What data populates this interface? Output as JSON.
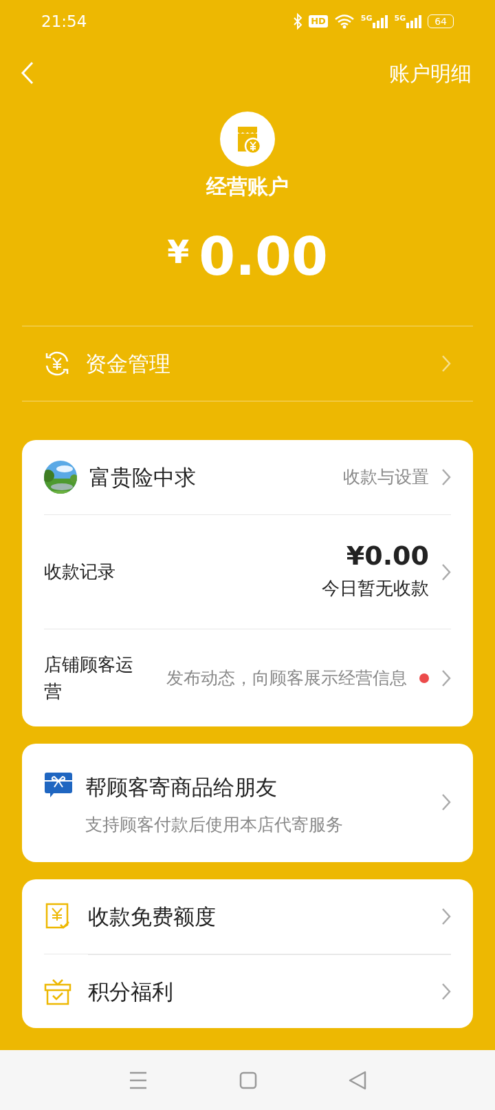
{
  "status_bar": {
    "time": "21:54",
    "hd": "HD",
    "networks": [
      "5G",
      "5G"
    ],
    "battery": "64"
  },
  "header": {
    "title": "账户明细"
  },
  "account": {
    "name": "经营账户",
    "currency": "¥",
    "amount": "0.00"
  },
  "fund_management": {
    "label": "资金管理"
  },
  "store_card": {
    "store_name": "富贵险中求",
    "settings_link": "收款与设置",
    "rows": [
      {
        "kind": "record",
        "label": "收款记录",
        "amount": "¥0.00",
        "note": "今日暂无收款"
      },
      {
        "kind": "hint",
        "label": "店铺顾客运营",
        "hint": "发布动态，向顾客展示经营信息",
        "unread": true
      }
    ]
  },
  "gift_card": {
    "title": "帮顾客寄商品给朋友",
    "subtitle": "支持顾客付款后使用本店代寄服务"
  },
  "benefits": [
    {
      "kind": "quota",
      "label": "收款免费额度"
    },
    {
      "kind": "gift",
      "label": "积分福利"
    }
  ]
}
